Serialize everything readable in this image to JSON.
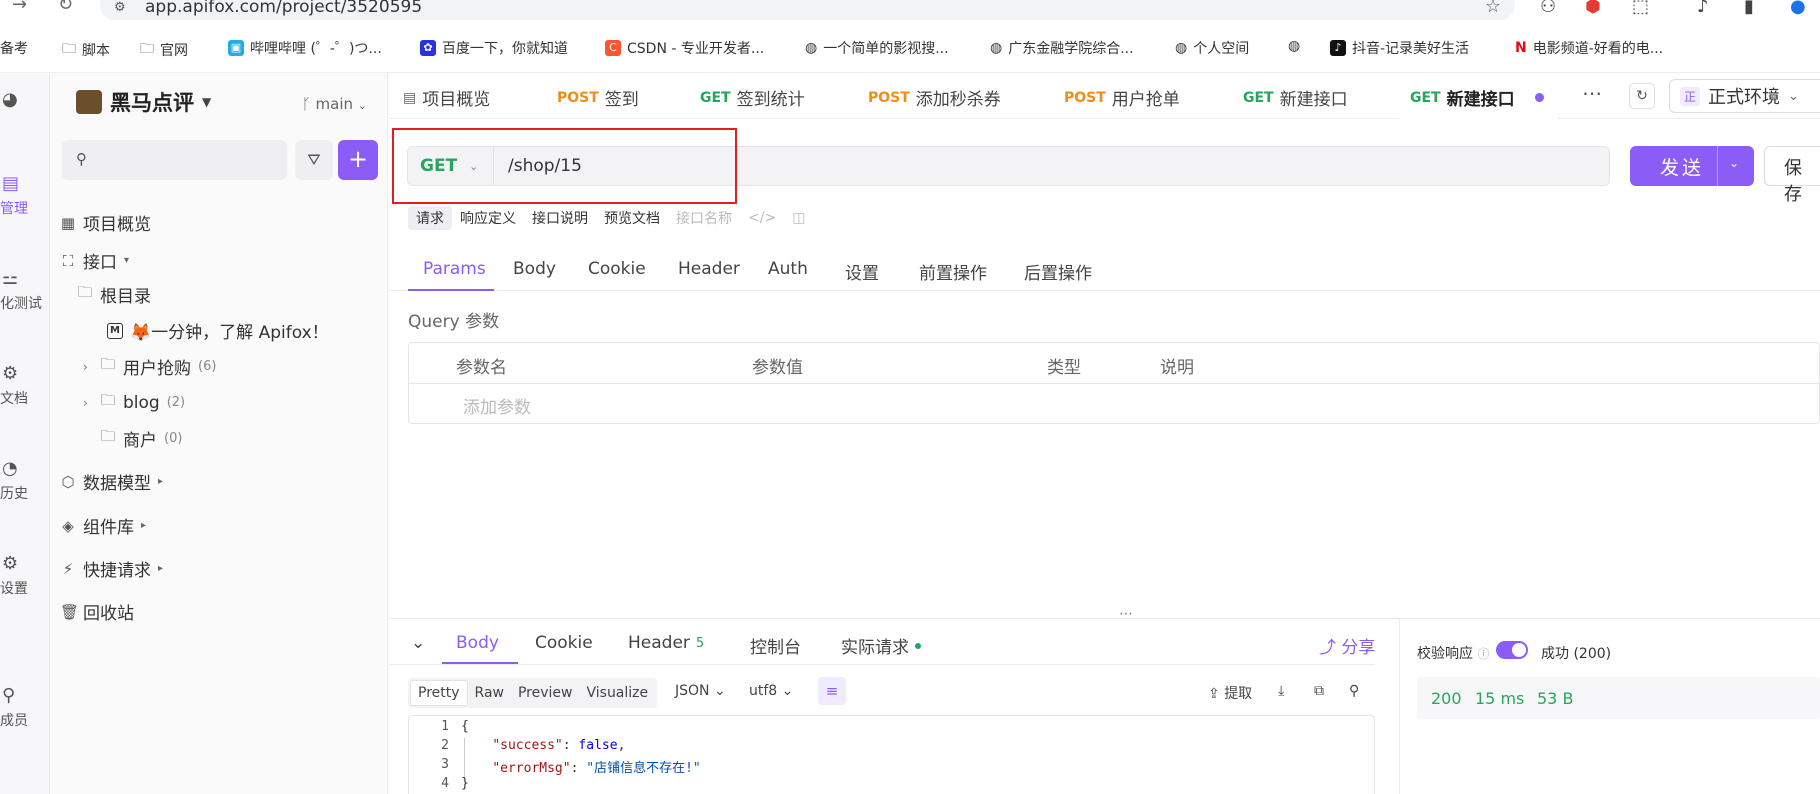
{
  "browser": {
    "url": "app.apifox.com/project/3520595",
    "bookmarks": [
      {
        "label": "备考"
      },
      {
        "label": "脚本"
      },
      {
        "label": "官网"
      },
      {
        "label": "哔哩哔哩 (゜-゜)つ..."
      },
      {
        "label": "百度一下，你就知道"
      },
      {
        "label": "CSDN - 专业开发者..."
      },
      {
        "label": "一个简单的影视搜..."
      },
      {
        "label": "广东金融学院综合..."
      },
      {
        "label": "个人空间"
      },
      {
        "label": ""
      },
      {
        "label": "抖音-记录美好生活"
      },
      {
        "label": "电影频道-好看的电..."
      }
    ]
  },
  "rail": {
    "items": [
      {
        "label": "管理",
        "icon": "api-manage-icon"
      },
      {
        "label": "化测试",
        "icon": "auto-test-icon"
      },
      {
        "label": "文档",
        "icon": "docs-icon"
      },
      {
        "label": "历史",
        "icon": "history-icon"
      },
      {
        "label": "设置",
        "icon": "settings-icon"
      },
      {
        "label": "成员",
        "icon": "members-icon"
      }
    ]
  },
  "sidebar": {
    "project_name": "黑马点评",
    "branch": "main",
    "search_placeholder": "",
    "items": [
      {
        "label": "项目概览"
      },
      {
        "label": "接口"
      },
      {
        "label": "根目录"
      },
      {
        "label": "🦊一分钟，了解 Apifox！"
      },
      {
        "label": "用户抢购",
        "count": "(6)"
      },
      {
        "label": "blog",
        "count": "(2)"
      },
      {
        "label": "商户",
        "count": "(0)"
      },
      {
        "label": "数据模型"
      },
      {
        "label": "组件库"
      },
      {
        "label": "快捷请求"
      },
      {
        "label": "回收站"
      }
    ]
  },
  "tabs": [
    {
      "method": "",
      "label": "项目概览"
    },
    {
      "method": "POST",
      "label": "签到"
    },
    {
      "method": "GET",
      "label": "签到统计"
    },
    {
      "method": "POST",
      "label": "添加秒杀券"
    },
    {
      "method": "POST",
      "label": "用户抢单"
    },
    {
      "method": "GET",
      "label": "新建接口"
    },
    {
      "method": "GET",
      "label": "新建接口"
    }
  ],
  "env": {
    "tag": "正",
    "label": "正式环境"
  },
  "request": {
    "method": "GET",
    "path": "/shop/15",
    "send_label": "发送",
    "save_label": "保 存"
  },
  "subtabs": [
    "请求",
    "响应定义",
    "接口说明",
    "预览文档",
    "接口名称"
  ],
  "param_tabs": [
    "Params",
    "Body",
    "Cookie",
    "Header",
    "Auth",
    "设置",
    "前置操作",
    "后置操作"
  ],
  "query": {
    "label": "Query 参数",
    "columns": [
      "参数名",
      "参数值",
      "类型",
      "说明"
    ],
    "add_placeholder": "添加参数"
  },
  "response": {
    "tabs": [
      {
        "label": "Body"
      },
      {
        "label": "Cookie"
      },
      {
        "label": "Header",
        "count": "5"
      },
      {
        "label": "控制台"
      },
      {
        "label": "实际请求"
      }
    ],
    "share_label": "分享",
    "formats": [
      "Pretty",
      "Raw",
      "Preview",
      "Visualize"
    ],
    "format_type": "JSON",
    "encoding": "utf8",
    "extract_label": "提取",
    "lines": [
      {
        "n": "1",
        "text": "{"
      },
      {
        "n": "2",
        "key": "\"success\"",
        "val": "false",
        "tail": ","
      },
      {
        "n": "3",
        "key": "\"errorMsg\"",
        "val": "\"店铺信息不存在!\"",
        "tail": ""
      },
      {
        "n": "4",
        "text": "}"
      }
    ]
  },
  "validation": {
    "label": "校验响应",
    "result": "成功 (200)",
    "status": "200",
    "time": "15 ms",
    "size": "53 B"
  },
  "colors": {
    "accent": "#8b5cf6",
    "get": "#26a65b",
    "post": "#f08c1a",
    "highlight_box": "#e02020"
  }
}
